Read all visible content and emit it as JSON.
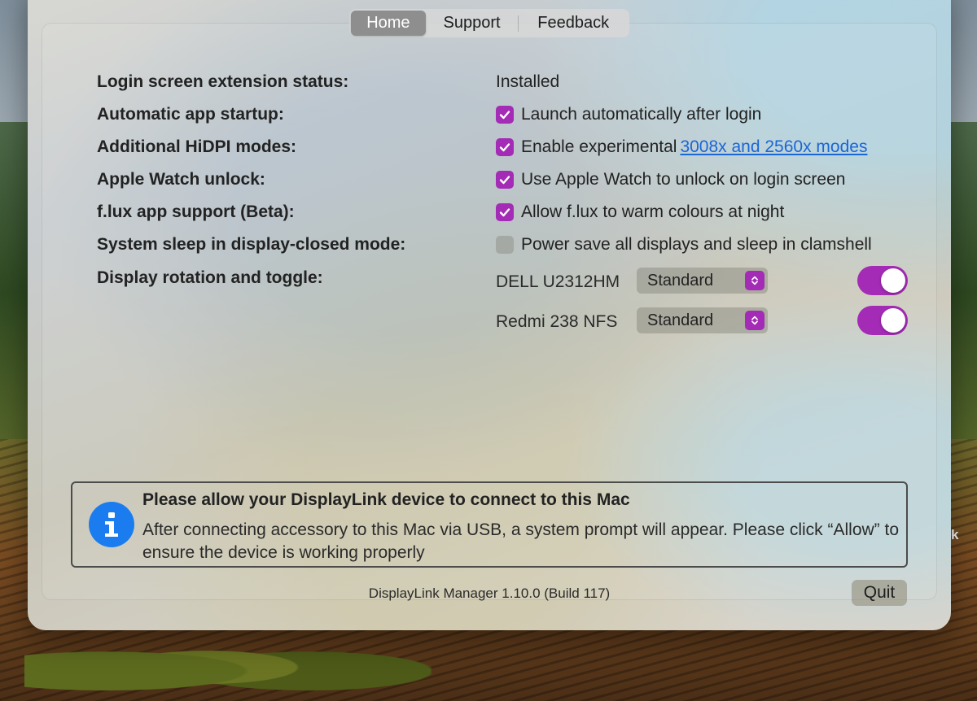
{
  "tabs": {
    "home": "Home",
    "support": "Support",
    "feedback": "Feedback",
    "active": "home"
  },
  "settings": {
    "login_screen": {
      "label": "Login screen extension status:",
      "value": "Installed"
    },
    "auto_startup": {
      "label": "Automatic app startup:",
      "checkbox_text": "Launch automatically after login",
      "checked": true
    },
    "hidpi": {
      "label": "Additional HiDPI modes:",
      "checkbox_text": "Enable experimental",
      "link_text": "3008x and 2560x modes",
      "checked": true
    },
    "watch_unlock": {
      "label": "Apple Watch unlock:",
      "checkbox_text": "Use Apple Watch to unlock on login screen",
      "checked": true
    },
    "flux": {
      "label": "f.lux app support (Beta):",
      "checkbox_text": "Allow f.lux to warm colours at night",
      "checked": true
    },
    "sleep": {
      "label": "System sleep in display-closed mode:",
      "checkbox_text": "Power save all displays and sleep in clamshell",
      "checked": false
    },
    "rotation": {
      "label": "Display rotation and toggle:"
    }
  },
  "displays": [
    {
      "name": "DELL U2312HM",
      "rotation": "Standard",
      "enabled": true
    },
    {
      "name": "Redmi 238 NFS",
      "rotation": "Standard",
      "enabled": true
    }
  ],
  "info": {
    "icon": "info-icon",
    "title": "Please allow your DisplayLink device to connect to this Mac",
    "body": "After connecting accessory to this Mac via USB, a system prompt will appear. Please click “Allow” to ensure the device is working properly"
  },
  "footer": {
    "version": "DisplayLink Manager 1.10.0 (Build 117)",
    "quit_label": "Quit"
  },
  "desktop": {
    "partial_text": "k"
  },
  "colors": {
    "accent": "#a32bb5",
    "link": "#1a66d6",
    "info_blue": "#1b7cf0"
  }
}
